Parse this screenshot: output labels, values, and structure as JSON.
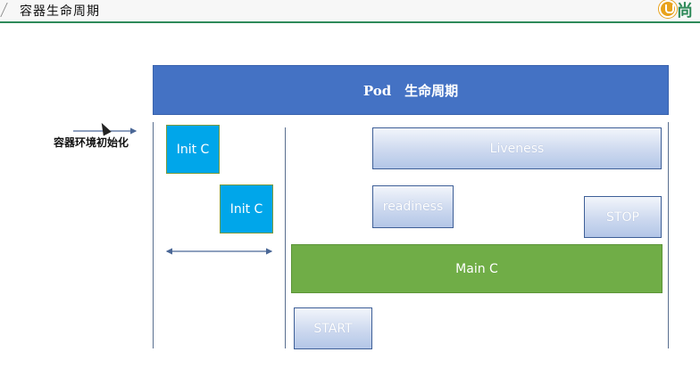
{
  "header": {
    "title": "容器生命周期",
    "logo_text": "尚",
    "logo_icon": "logo-icon"
  },
  "diagram": {
    "pod_title": "Pod　生命周期",
    "env_init_label": "容器环境初始化",
    "init_containers": [
      "Init C",
      "Init C"
    ],
    "liveness_label": "Liveness",
    "readiness_label": "readiness",
    "stop_label": "STOP",
    "main_label": "Main C",
    "start_label": "START"
  },
  "colors": {
    "pod_bar": "#4472c4",
    "init_box": "#00a6ea",
    "main_box": "#70ad47",
    "header_rule": "#2f8a5a",
    "probe_border": "#3e5f97"
  }
}
